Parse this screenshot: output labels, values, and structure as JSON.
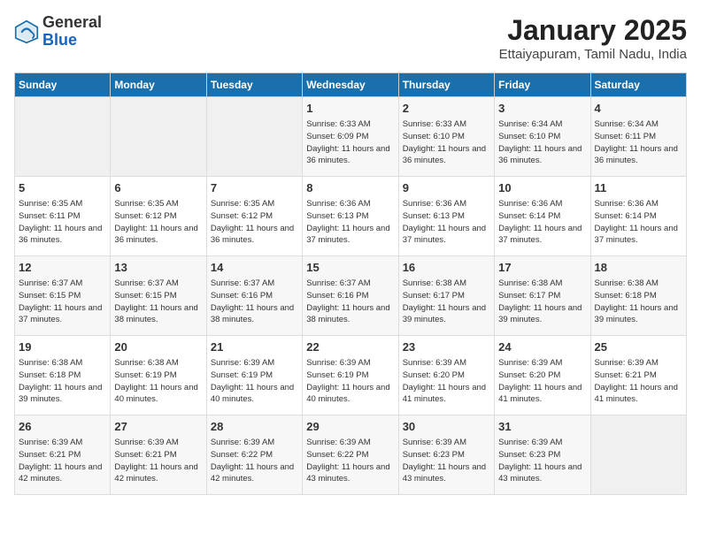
{
  "header": {
    "logo_general": "General",
    "logo_blue": "Blue",
    "title": "January 2025",
    "subtitle": "Ettaiyapuram, Tamil Nadu, India"
  },
  "weekdays": [
    "Sunday",
    "Monday",
    "Tuesday",
    "Wednesday",
    "Thursday",
    "Friday",
    "Saturday"
  ],
  "weeks": [
    [
      {
        "day": "",
        "detail": ""
      },
      {
        "day": "",
        "detail": ""
      },
      {
        "day": "",
        "detail": ""
      },
      {
        "day": "1",
        "detail": "Sunrise: 6:33 AM\nSunset: 6:09 PM\nDaylight: 11 hours\nand 36 minutes."
      },
      {
        "day": "2",
        "detail": "Sunrise: 6:33 AM\nSunset: 6:10 PM\nDaylight: 11 hours\nand 36 minutes."
      },
      {
        "day": "3",
        "detail": "Sunrise: 6:34 AM\nSunset: 6:10 PM\nDaylight: 11 hours\nand 36 minutes."
      },
      {
        "day": "4",
        "detail": "Sunrise: 6:34 AM\nSunset: 6:11 PM\nDaylight: 11 hours\nand 36 minutes."
      }
    ],
    [
      {
        "day": "5",
        "detail": "Sunrise: 6:35 AM\nSunset: 6:11 PM\nDaylight: 11 hours\nand 36 minutes."
      },
      {
        "day": "6",
        "detail": "Sunrise: 6:35 AM\nSunset: 6:12 PM\nDaylight: 11 hours\nand 36 minutes."
      },
      {
        "day": "7",
        "detail": "Sunrise: 6:35 AM\nSunset: 6:12 PM\nDaylight: 11 hours\nand 36 minutes."
      },
      {
        "day": "8",
        "detail": "Sunrise: 6:36 AM\nSunset: 6:13 PM\nDaylight: 11 hours\nand 37 minutes."
      },
      {
        "day": "9",
        "detail": "Sunrise: 6:36 AM\nSunset: 6:13 PM\nDaylight: 11 hours\nand 37 minutes."
      },
      {
        "day": "10",
        "detail": "Sunrise: 6:36 AM\nSunset: 6:14 PM\nDaylight: 11 hours\nand 37 minutes."
      },
      {
        "day": "11",
        "detail": "Sunrise: 6:36 AM\nSunset: 6:14 PM\nDaylight: 11 hours\nand 37 minutes."
      }
    ],
    [
      {
        "day": "12",
        "detail": "Sunrise: 6:37 AM\nSunset: 6:15 PM\nDaylight: 11 hours\nand 37 minutes."
      },
      {
        "day": "13",
        "detail": "Sunrise: 6:37 AM\nSunset: 6:15 PM\nDaylight: 11 hours\nand 38 minutes."
      },
      {
        "day": "14",
        "detail": "Sunrise: 6:37 AM\nSunset: 6:16 PM\nDaylight: 11 hours\nand 38 minutes."
      },
      {
        "day": "15",
        "detail": "Sunrise: 6:37 AM\nSunset: 6:16 PM\nDaylight: 11 hours\nand 38 minutes."
      },
      {
        "day": "16",
        "detail": "Sunrise: 6:38 AM\nSunset: 6:17 PM\nDaylight: 11 hours\nand 39 minutes."
      },
      {
        "day": "17",
        "detail": "Sunrise: 6:38 AM\nSunset: 6:17 PM\nDaylight: 11 hours\nand 39 minutes."
      },
      {
        "day": "18",
        "detail": "Sunrise: 6:38 AM\nSunset: 6:18 PM\nDaylight: 11 hours\nand 39 minutes."
      }
    ],
    [
      {
        "day": "19",
        "detail": "Sunrise: 6:38 AM\nSunset: 6:18 PM\nDaylight: 11 hours\nand 39 minutes."
      },
      {
        "day": "20",
        "detail": "Sunrise: 6:38 AM\nSunset: 6:19 PM\nDaylight: 11 hours\nand 40 minutes."
      },
      {
        "day": "21",
        "detail": "Sunrise: 6:39 AM\nSunset: 6:19 PM\nDaylight: 11 hours\nand 40 minutes."
      },
      {
        "day": "22",
        "detail": "Sunrise: 6:39 AM\nSunset: 6:19 PM\nDaylight: 11 hours\nand 40 minutes."
      },
      {
        "day": "23",
        "detail": "Sunrise: 6:39 AM\nSunset: 6:20 PM\nDaylight: 11 hours\nand 41 minutes."
      },
      {
        "day": "24",
        "detail": "Sunrise: 6:39 AM\nSunset: 6:20 PM\nDaylight: 11 hours\nand 41 minutes."
      },
      {
        "day": "25",
        "detail": "Sunrise: 6:39 AM\nSunset: 6:21 PM\nDaylight: 11 hours\nand 41 minutes."
      }
    ],
    [
      {
        "day": "26",
        "detail": "Sunrise: 6:39 AM\nSunset: 6:21 PM\nDaylight: 11 hours\nand 42 minutes."
      },
      {
        "day": "27",
        "detail": "Sunrise: 6:39 AM\nSunset: 6:21 PM\nDaylight: 11 hours\nand 42 minutes."
      },
      {
        "day": "28",
        "detail": "Sunrise: 6:39 AM\nSunset: 6:22 PM\nDaylight: 11 hours\nand 42 minutes."
      },
      {
        "day": "29",
        "detail": "Sunrise: 6:39 AM\nSunset: 6:22 PM\nDaylight: 11 hours\nand 43 minutes."
      },
      {
        "day": "30",
        "detail": "Sunrise: 6:39 AM\nSunset: 6:23 PM\nDaylight: 11 hours\nand 43 minutes."
      },
      {
        "day": "31",
        "detail": "Sunrise: 6:39 AM\nSunset: 6:23 PM\nDaylight: 11 hours\nand 43 minutes."
      },
      {
        "day": "",
        "detail": ""
      }
    ]
  ]
}
